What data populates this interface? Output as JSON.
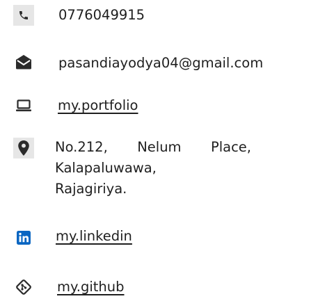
{
  "contact": {
    "phone": {
      "icon": "phone-icon",
      "text": "0776049915"
    },
    "email": {
      "icon": "envelope-icon",
      "text": "pasandiayodya04@gmail.com"
    },
    "portfolio": {
      "icon": "laptop-icon",
      "text": "my.portfolio"
    },
    "address": {
      "icon": "location-pin-icon",
      "line1_words": [
        "No.212,",
        "Nelum",
        "Place,"
      ],
      "line2": "Kalapaluwawa,",
      "line3": "Rajagiriya."
    },
    "linkedin": {
      "icon": "linkedin-icon",
      "text": "my.linkedin"
    },
    "github": {
      "icon": "git-icon",
      "text": "my.github"
    }
  },
  "colors": {
    "icon_background": "#e6e6e6",
    "icon_dark": "#2b2b2b",
    "linkedin_blue": "#0a66c2",
    "text": "#1f1f1f"
  }
}
